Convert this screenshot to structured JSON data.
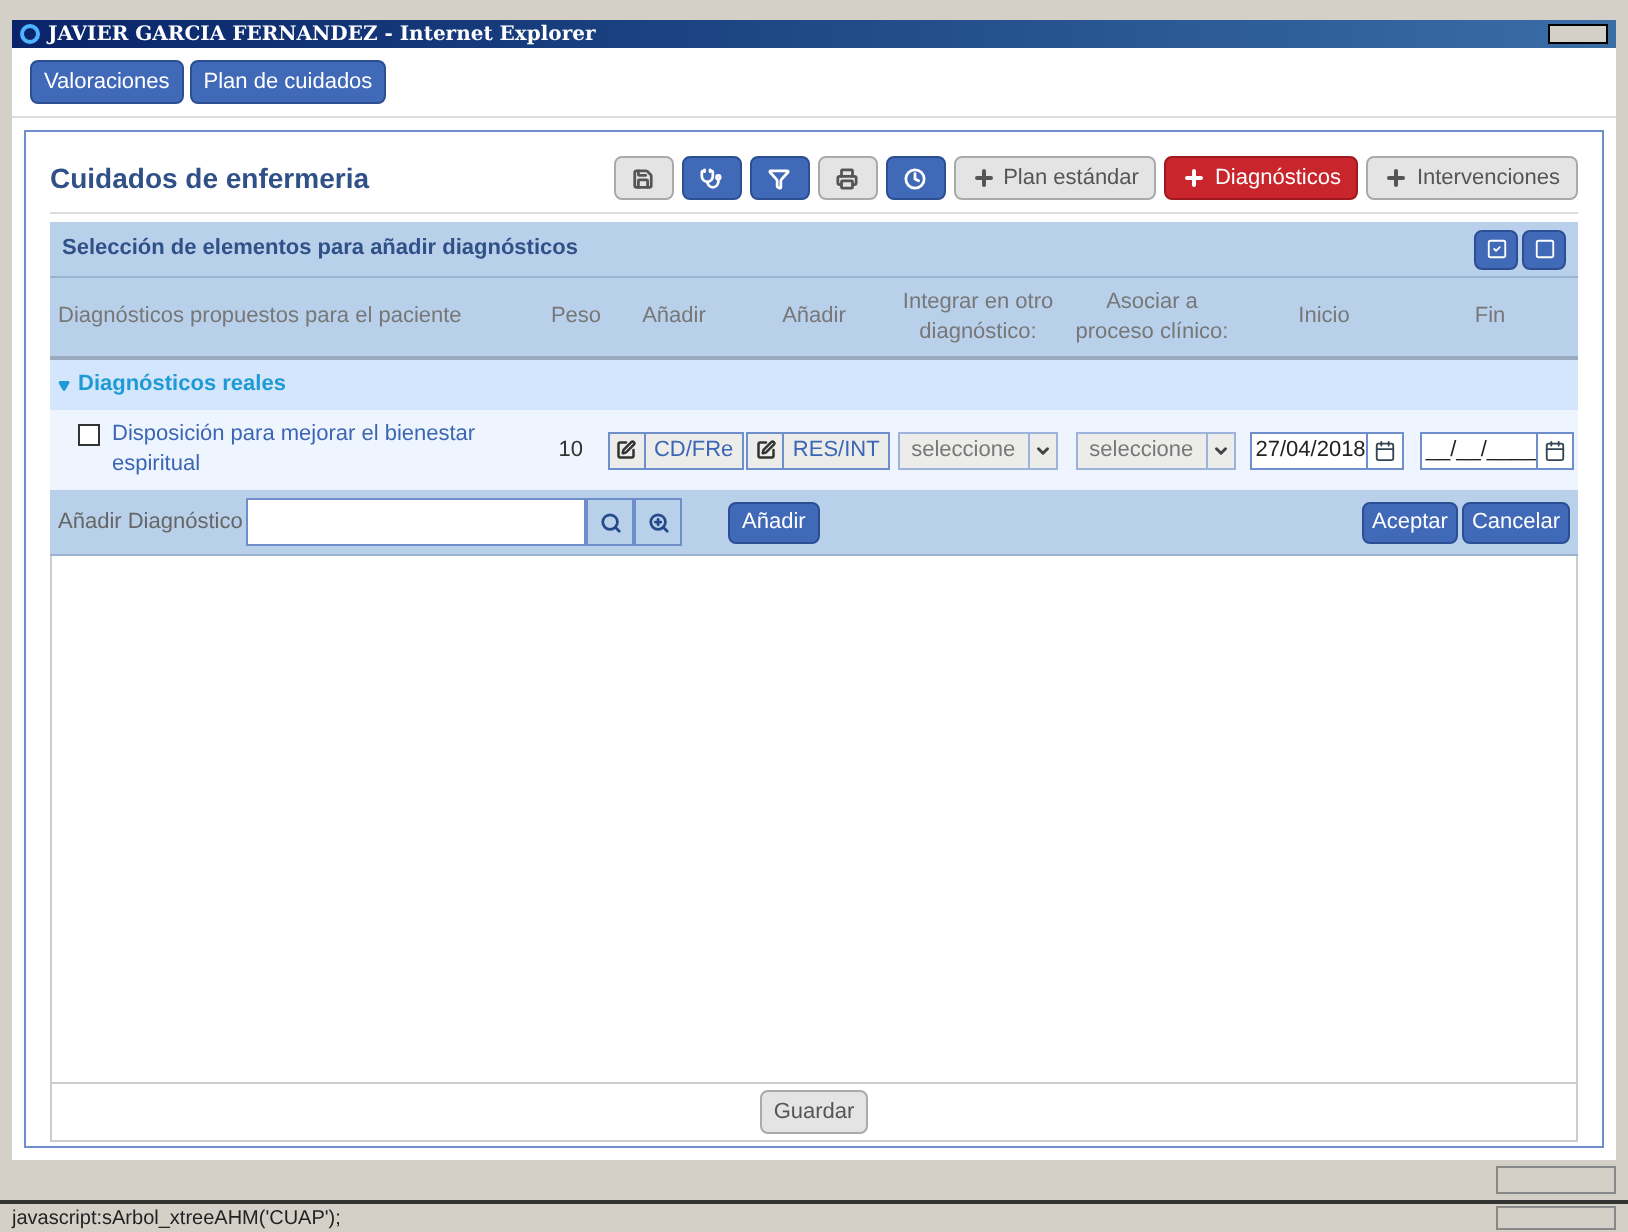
{
  "window": {
    "title": "JAVIER GARCIA FERNANDEZ - Internet Explorer"
  },
  "nav_tabs": [
    {
      "label": "Valoraciones"
    },
    {
      "label": "Plan de cuidados"
    }
  ],
  "panel": {
    "title": "Cuidados de enfermeria",
    "toolbar": [
      {
        "kind": "icon"
      },
      {
        "kind": "icon"
      },
      {
        "kind": "icon"
      },
      {
        "kind": "icon"
      },
      {
        "kind": "icon"
      },
      {
        "kind": "text",
        "label": "Plan estándar",
        "selected": false
      },
      {
        "kind": "text",
        "label": "Diagnósticos",
        "selected": true
      },
      {
        "kind": "text",
        "label": "Intervenciones",
        "selected": false
      }
    ]
  },
  "selection": {
    "title": "Selección de elementos para añadir diagnósticos",
    "columns": [
      "Diagnósticos propuestos para el paciente",
      "Peso",
      "Añadir",
      "Añadir",
      "Integrar en otro diagnóstico:",
      "Asociar a proceso clínico:",
      "Inicio",
      "Fin"
    ],
    "group": {
      "label": "Diagnósticos reales",
      "expanded": true
    },
    "rows": [
      {
        "name": "Disposición para mejorar el bienestar espiritual",
        "checked": false,
        "peso": "10",
        "add_1": "CD/FRe",
        "add_2": "RES/INT",
        "integrar": "seleccione",
        "asociar": "seleccione",
        "inicio": "27/04/2018",
        "fin": "__/__/____"
      }
    ]
  },
  "add_bar": {
    "label": "Añadir Diagnóstico",
    "add": "Añadir",
    "accept": "Aceptar",
    "cancel": "Cancelar"
  },
  "save": "Guardar",
  "status_bar": "javascript:sArbol_xtreeAHM('CUAP');"
}
